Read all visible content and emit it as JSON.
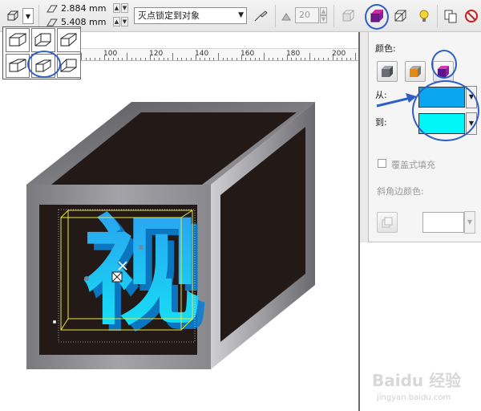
{
  "toolbar": {
    "x_value": "2.884 mm",
    "y_value": "5.408 mm",
    "vanishing_point_option": "灭点锁定到对象",
    "depth_value": "20"
  },
  "ruler": {
    "labels": [
      "100",
      "120",
      "140",
      "160",
      "180",
      "200"
    ]
  },
  "panel": {
    "color_label": "颜色:",
    "from_label": "从:",
    "to_label": "到:",
    "overprint_label": "覆盖式填充",
    "bevel_color_label": "斜角边颜色:",
    "from_color": "#0aa7f0",
    "to_color": "#00f6f8"
  },
  "canvas": {
    "glyph": "视"
  },
  "watermark": {
    "brand": "Baidu 经验",
    "url": "jingyan.baidu.com"
  },
  "colors": {
    "annotation_ring": "#2e5fc7",
    "cube_face": "#231a18",
    "cube_frame": "#8a8a8e"
  }
}
